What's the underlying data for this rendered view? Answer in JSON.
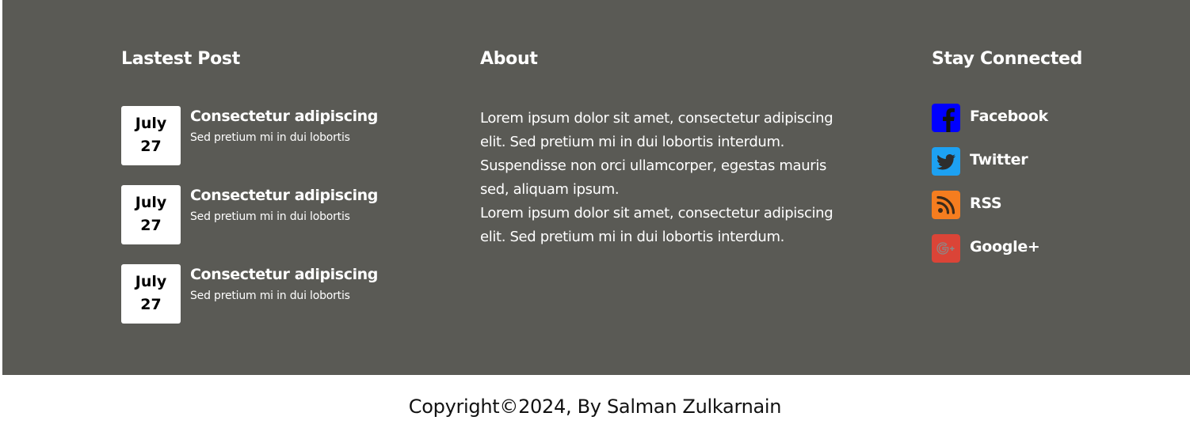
{
  "latest_post": {
    "title": "Lastest Post",
    "posts": [
      {
        "month": "July",
        "day": "27",
        "title": "Consectetur adipiscing",
        "subtitle": "Sed pretium mi in dui lobortis"
      },
      {
        "month": "July",
        "day": "27",
        "title": "Consectetur adipiscing",
        "subtitle": "Sed pretium mi in dui lobortis"
      },
      {
        "month": "July",
        "day": "27",
        "title": "Consectetur adipiscing",
        "subtitle": "Sed pretium mi in dui lobortis"
      }
    ]
  },
  "about": {
    "title": "About",
    "paragraphs": [
      "Lorem ipsum dolor sit amet, consectetur adipiscing elit. Sed pretium mi in dui lobortis interdum. Suspendisse non orci ullamcorper, egestas mauris sed, aliquam ipsum.",
      "Lorem ipsum dolor sit amet, consectetur adipiscing elit. Sed pretium mi in dui lobortis interdum."
    ]
  },
  "stay_connected": {
    "title": "Stay Connected",
    "links": [
      {
        "label": "Facebook",
        "icon": "facebook-icon",
        "color": "#0000ff"
      },
      {
        "label": "Twitter",
        "icon": "twitter-icon",
        "color": "#1da1f2"
      },
      {
        "label": "RSS",
        "icon": "rss-icon",
        "color": "#f57d1f"
      },
      {
        "label": "Google+",
        "icon": "google-plus-icon",
        "color": "#db4437"
      }
    ]
  },
  "colors": {
    "footer_background": "#5a5a55",
    "page_background": "#ffffff"
  },
  "copyright": "Copyright©2024, By Salman Zulkarnain"
}
